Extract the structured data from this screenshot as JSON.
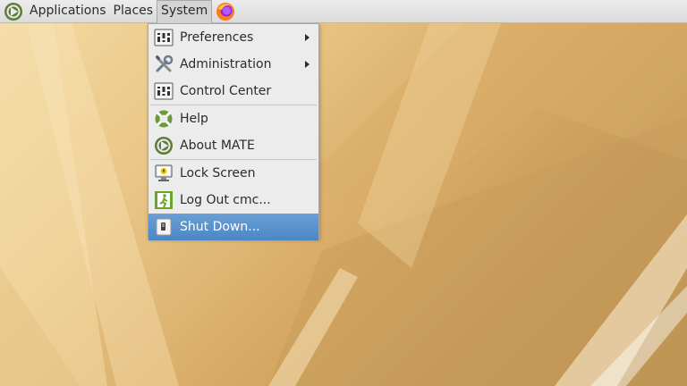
{
  "panel": {
    "logo_icon": "mate-logo-icon",
    "applications_label": "Applications",
    "places_label": "Places",
    "system_label": "System",
    "firefox_icon": "firefox-icon"
  },
  "system_menu": {
    "items": [
      {
        "label": "Preferences",
        "icon": "preferences-icon",
        "submenu": true
      },
      {
        "label": "Administration",
        "icon": "tools-icon",
        "submenu": true
      },
      {
        "label": "Control Center",
        "icon": "control-center-icon",
        "submenu": false
      },
      {
        "label": "Help",
        "icon": "help-lifebuoy-icon",
        "submenu": false
      },
      {
        "label": "About MATE",
        "icon": "mate-logo-icon",
        "submenu": false
      },
      {
        "label": "Lock Screen",
        "icon": "lock-screen-icon",
        "submenu": false
      },
      {
        "label": "Log Out cmc...",
        "icon": "logout-icon",
        "submenu": false
      },
      {
        "label": "Shut Down...",
        "icon": "shutdown-icon",
        "submenu": false,
        "highlighted": true
      }
    ]
  },
  "colors": {
    "selection": "#4c86c4",
    "panel_bg": "#e4e4e4",
    "desktop_gold": "#e9c686"
  }
}
